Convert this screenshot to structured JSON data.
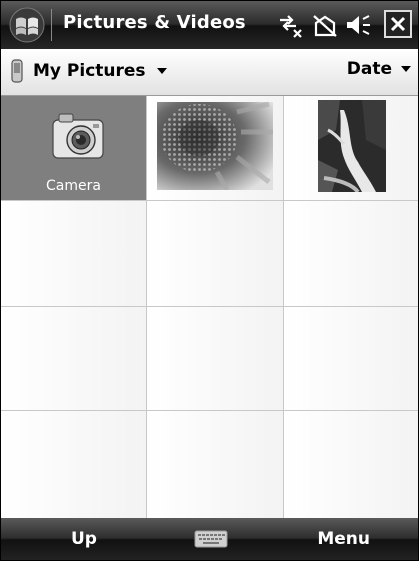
{
  "titlebar": {
    "title": "Pictures & Videos",
    "icons": [
      "windows-start-icon",
      "connectivity-icon",
      "phone-signal-off-icon",
      "volume-icon",
      "close-icon"
    ]
  },
  "folderbar": {
    "folder": "My Pictures",
    "sort": "Date"
  },
  "grid": {
    "items": [
      {
        "label": "Camera",
        "type": "camera",
        "selected": true
      },
      {
        "label": "",
        "type": "photo-flower",
        "selected": false
      },
      {
        "label": "",
        "type": "photo-waterfall",
        "selected": false
      }
    ],
    "empty_rows": 3
  },
  "softbar": {
    "left": "Up",
    "right": "Menu",
    "icon": "keyboard-icon"
  },
  "colors": {
    "bar_dark": "#1a1a1a",
    "selected_cell": "#7f7f7f",
    "grid_line": "#c8c8c8"
  }
}
